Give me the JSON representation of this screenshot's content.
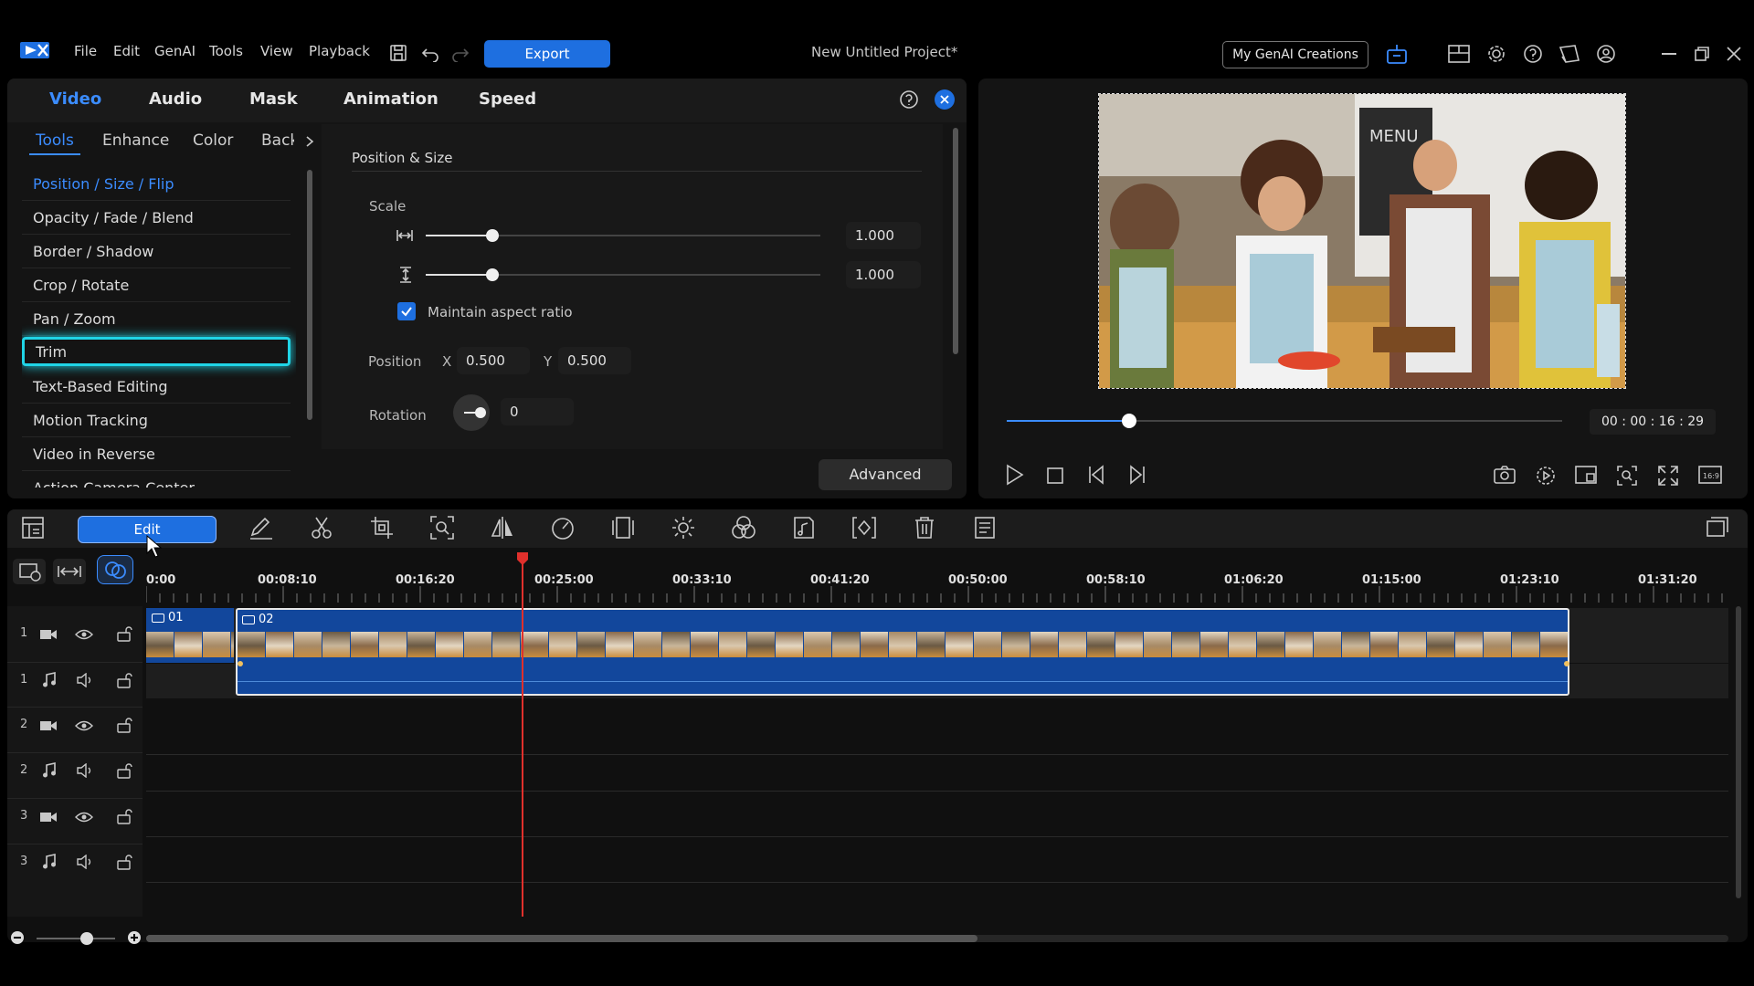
{
  "menubar": {
    "items": [
      "File",
      "Edit",
      "GenAI",
      "Tools",
      "View",
      "Playback"
    ],
    "export_label": "Export",
    "project_title": "New Untitled Project*",
    "genai_creations_label": "My GenAI Creations"
  },
  "editor": {
    "tabs": [
      "Video",
      "Audio",
      "Mask",
      "Animation",
      "Speed"
    ],
    "active_tab": "Video",
    "subtabs": [
      "Tools",
      "Enhance",
      "Color",
      "Backg"
    ],
    "active_subtab": "Tools",
    "tool_items": [
      "Position / Size / Flip",
      "Opacity / Fade / Blend",
      "Border / Shadow",
      "Crop / Rotate",
      "Pan / Zoom",
      "Trim",
      "Text-Based Editing",
      "Motion Tracking",
      "Video in Reverse",
      "Action Camera Center"
    ],
    "selected_tool": "Position / Size / Flip",
    "highlighted_tool": "Trim"
  },
  "position_size": {
    "section_title": "Position & Size",
    "scale_label": "Scale",
    "scale_width_value": "1.000",
    "scale_height_value": "1.000",
    "maintain_aspect_label": "Maintain aspect ratio",
    "maintain_aspect_checked": true,
    "position_label": "Position",
    "x_label": "X",
    "x_value": "0.500",
    "y_label": "Y",
    "y_value": "0.500",
    "rotation_label": "Rotation",
    "rotation_value": "0",
    "advanced_label": "Advanced"
  },
  "preview": {
    "timecode": "00 : 00 : 16 : 29",
    "progress": 0.22,
    "menu_board_text": "MENU"
  },
  "timeline": {
    "edit_label": "Edit",
    "ruler_labels": [
      "0:00",
      "00:08:10",
      "00:16:20",
      "00:25:00",
      "00:33:10",
      "00:41:20",
      "00:50:00",
      "00:58:10",
      "01:06:20",
      "01:15:00",
      "01:23:10",
      "01:31:20"
    ],
    "clips": [
      {
        "name": "01"
      },
      {
        "name": "02"
      }
    ],
    "tracks": [
      {
        "num": "1",
        "type": "video"
      },
      {
        "num": "1",
        "type": "audio"
      },
      {
        "num": "2",
        "type": "video"
      },
      {
        "num": "2",
        "type": "audio"
      },
      {
        "num": "3",
        "type": "video"
      },
      {
        "num": "3",
        "type": "audio"
      }
    ]
  },
  "colors": {
    "accent": "#1e6fe0",
    "highlight_glow": "#20d4e6",
    "playhead": "#e0302c",
    "clip_blue": "#12479c"
  }
}
